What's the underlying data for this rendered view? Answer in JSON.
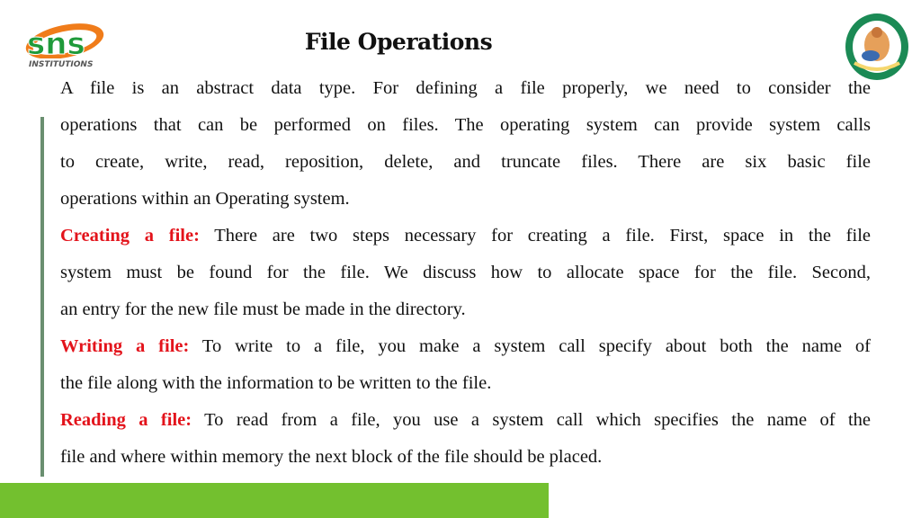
{
  "logos": {
    "left": {
      "icon": "sns-institutions-logo",
      "text_main": "sns",
      "text_sub": "INSTITUTIONS",
      "colors": {
        "green": "#1f9a3a",
        "orange": "#f07c1a"
      }
    },
    "right": {
      "icon": "college-emblem-logo",
      "color": "#1b8a55"
    }
  },
  "slide": {
    "title": "File Operations",
    "lines": [
      {
        "text": "A file is an abstract data type. For defining a file properly, we need to consider the"
      },
      {
        "text": "operations that can be performed on files. The operating system can provide system calls"
      },
      {
        "text": "to create, write, read, reposition, delete, and truncate files. There are six basic file"
      },
      {
        "text": "operations within an Operating system.",
        "last": true
      },
      {
        "label": "Creating a file:",
        "text": " There are two steps necessary for creating a file. First, space in the file"
      },
      {
        "text": "system must be found for the file. We discuss how to allocate space for the file. Second,"
      },
      {
        "text": "an entry for the new file must be made in the directory.",
        "last": true
      },
      {
        "label": "Writing a file:",
        "text": " To write to a file, you make a system call specify about both the name of"
      },
      {
        "text": "the file along with the information to be written to the file.",
        "last": true
      },
      {
        "label": "Reading a file:",
        "text": " To read from a file, you use a system call which specifies the name of the"
      },
      {
        "text": "file and where within memory the next block of the file should be placed.",
        "last": true
      }
    ]
  },
  "colors": {
    "heading_red": "#e3131b",
    "accent_bar": "#6a8f70",
    "footer_green": "#73c02f"
  }
}
